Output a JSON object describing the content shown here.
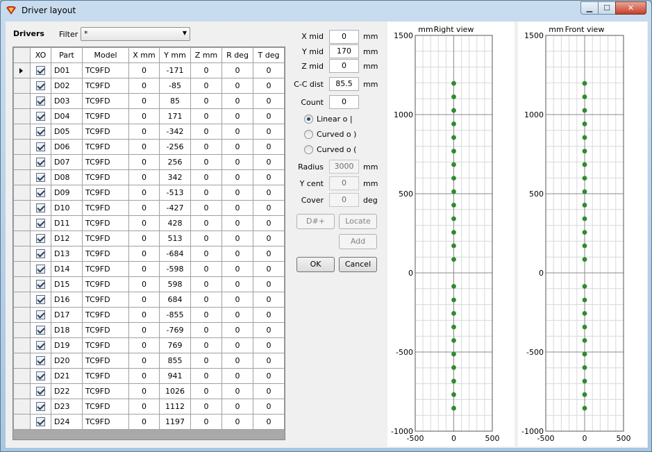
{
  "window": {
    "title": "Driver layout",
    "minimize": "▁",
    "maximize": "☐",
    "close": "✕"
  },
  "left": {
    "drivers_label": "Drivers",
    "filter_label": "Filter",
    "filter_value": "*"
  },
  "table": {
    "columns": [
      "XO",
      "Part",
      "Model",
      "X mm",
      "Y mm",
      "Z mm",
      "R deg",
      "T deg"
    ],
    "rows": [
      {
        "xo": true,
        "part": "D01",
        "model": "TC9FD",
        "x": "0",
        "y": "-171",
        "z": "0",
        "r": "0",
        "t": "0"
      },
      {
        "xo": true,
        "part": "D02",
        "model": "TC9FD",
        "x": "0",
        "y": "-85",
        "z": "0",
        "r": "0",
        "t": "0"
      },
      {
        "xo": true,
        "part": "D03",
        "model": "TC9FD",
        "x": "0",
        "y": "85",
        "z": "0",
        "r": "0",
        "t": "0"
      },
      {
        "xo": true,
        "part": "D04",
        "model": "TC9FD",
        "x": "0",
        "y": "171",
        "z": "0",
        "r": "0",
        "t": "0"
      },
      {
        "xo": true,
        "part": "D05",
        "model": "TC9FD",
        "x": "0",
        "y": "-342",
        "z": "0",
        "r": "0",
        "t": "0"
      },
      {
        "xo": true,
        "part": "D06",
        "model": "TC9FD",
        "x": "0",
        "y": "-256",
        "z": "0",
        "r": "0",
        "t": "0"
      },
      {
        "xo": true,
        "part": "D07",
        "model": "TC9FD",
        "x": "0",
        "y": "256",
        "z": "0",
        "r": "0",
        "t": "0"
      },
      {
        "xo": true,
        "part": "D08",
        "model": "TC9FD",
        "x": "0",
        "y": "342",
        "z": "0",
        "r": "0",
        "t": "0"
      },
      {
        "xo": true,
        "part": "D09",
        "model": "TC9FD",
        "x": "0",
        "y": "-513",
        "z": "0",
        "r": "0",
        "t": "0"
      },
      {
        "xo": true,
        "part": "D10",
        "model": "TC9FD",
        "x": "0",
        "y": "-427",
        "z": "0",
        "r": "0",
        "t": "0"
      },
      {
        "xo": true,
        "part": "D11",
        "model": "TC9FD",
        "x": "0",
        "y": "428",
        "z": "0",
        "r": "0",
        "t": "0"
      },
      {
        "xo": true,
        "part": "D12",
        "model": "TC9FD",
        "x": "0",
        "y": "513",
        "z": "0",
        "r": "0",
        "t": "0"
      },
      {
        "xo": true,
        "part": "D13",
        "model": "TC9FD",
        "x": "0",
        "y": "-684",
        "z": "0",
        "r": "0",
        "t": "0"
      },
      {
        "xo": true,
        "part": "D14",
        "model": "TC9FD",
        "x": "0",
        "y": "-598",
        "z": "0",
        "r": "0",
        "t": "0"
      },
      {
        "xo": true,
        "part": "D15",
        "model": "TC9FD",
        "x": "0",
        "y": "598",
        "z": "0",
        "r": "0",
        "t": "0"
      },
      {
        "xo": true,
        "part": "D16",
        "model": "TC9FD",
        "x": "0",
        "y": "684",
        "z": "0",
        "r": "0",
        "t": "0"
      },
      {
        "xo": true,
        "part": "D17",
        "model": "TC9FD",
        "x": "0",
        "y": "-855",
        "z": "0",
        "r": "0",
        "t": "0"
      },
      {
        "xo": true,
        "part": "D18",
        "model": "TC9FD",
        "x": "0",
        "y": "-769",
        "z": "0",
        "r": "0",
        "t": "0"
      },
      {
        "xo": true,
        "part": "D19",
        "model": "TC9FD",
        "x": "0",
        "y": "769",
        "z": "0",
        "r": "0",
        "t": "0"
      },
      {
        "xo": true,
        "part": "D20",
        "model": "TC9FD",
        "x": "0",
        "y": "855",
        "z": "0",
        "r": "0",
        "t": "0"
      },
      {
        "xo": true,
        "part": "D21",
        "model": "TC9FD",
        "x": "0",
        "y": "941",
        "z": "0",
        "r": "0",
        "t": "0"
      },
      {
        "xo": true,
        "part": "D22",
        "model": "TC9FD",
        "x": "0",
        "y": "1026",
        "z": "0",
        "r": "0",
        "t": "0"
      },
      {
        "xo": true,
        "part": "D23",
        "model": "TC9FD",
        "x": "0",
        "y": "1112",
        "z": "0",
        "r": "0",
        "t": "0"
      },
      {
        "xo": true,
        "part": "D24",
        "model": "TC9FD",
        "x": "0",
        "y": "1197",
        "z": "0",
        "r": "0",
        "t": "0"
      }
    ]
  },
  "form": {
    "x_mid_label": "X mid",
    "x_mid_value": "0",
    "x_mid_unit": "mm",
    "y_mid_label": "Y mid",
    "y_mid_value": "170",
    "y_mid_unit": "mm",
    "z_mid_label": "Z mid",
    "z_mid_value": "0",
    "z_mid_unit": "mm",
    "cc_dist_label": "C-C dist",
    "cc_dist_value": "85.5",
    "cc_dist_unit": "mm",
    "count_label": "Count",
    "count_value": "0",
    "radio_linear": "Linear  o  |",
    "radio_curved_1": "Curved  o  )",
    "radio_curved_2": "Curved  o  (",
    "radius_label": "Radius",
    "radius_value": "3000",
    "radius_unit": "mm",
    "y_cent_label": "Y cent",
    "y_cent_value": "0",
    "y_cent_unit": "mm",
    "cover_label": "Cover",
    "cover_value": "0",
    "cover_unit": "deg",
    "btn_dnum": "D#+",
    "btn_locate": "Locate",
    "btn_add": "Add",
    "btn_ok": "OK",
    "btn_cancel": "Cancel"
  },
  "chart_data": [
    {
      "type": "scatter",
      "title": "Right view",
      "ylabel": "mm",
      "xlim": [
        -500,
        500
      ],
      "ylim": [
        -1000,
        1500
      ],
      "xticks": [
        -500,
        0,
        500
      ],
      "yticks": [
        1500,
        1000,
        500,
        0,
        -500,
        -1000
      ],
      "grid": true,
      "marker_color": "#2e8b2e",
      "x": [
        0,
        0,
        0,
        0,
        0,
        0,
        0,
        0,
        0,
        0,
        0,
        0,
        0,
        0,
        0,
        0,
        0,
        0,
        0,
        0,
        0,
        0,
        0,
        0
      ],
      "y": [
        -171,
        -85,
        85,
        171,
        -342,
        -256,
        256,
        342,
        -513,
        -427,
        428,
        513,
        -684,
        -598,
        598,
        684,
        -855,
        -769,
        769,
        855,
        941,
        1026,
        1112,
        1197
      ]
    },
    {
      "type": "scatter",
      "title": "Front view",
      "ylabel": "mm",
      "xlim": [
        -500,
        500
      ],
      "ylim": [
        -1000,
        1500
      ],
      "xticks": [
        -500,
        0,
        500
      ],
      "yticks": [
        1500,
        1000,
        500,
        0,
        -500,
        -1000
      ],
      "grid": true,
      "marker_color": "#2e8b2e",
      "x": [
        0,
        0,
        0,
        0,
        0,
        0,
        0,
        0,
        0,
        0,
        0,
        0,
        0,
        0,
        0,
        0,
        0,
        0,
        0,
        0,
        0,
        0,
        0,
        0
      ],
      "y": [
        -171,
        -85,
        85,
        171,
        -342,
        -256,
        256,
        342,
        -513,
        -427,
        428,
        513,
        -684,
        -598,
        598,
        684,
        -855,
        -769,
        769,
        855,
        941,
        1026,
        1112,
        1197
      ]
    }
  ]
}
